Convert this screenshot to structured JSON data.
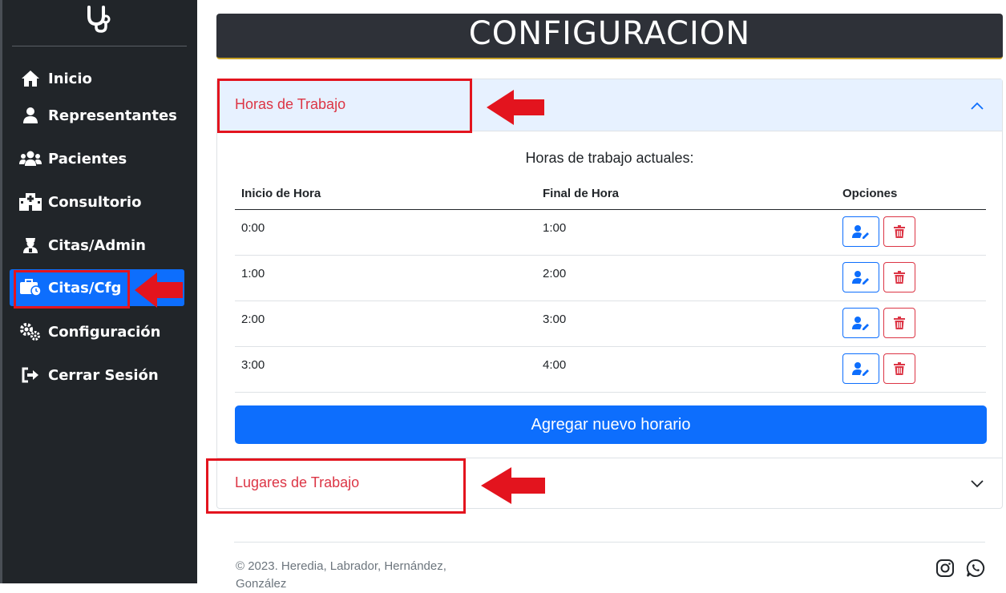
{
  "page_title": "CONFIGURACION",
  "sidebar": {
    "logo_icon": "stethoscope-icon",
    "items": [
      {
        "label": "Inicio",
        "icon": "house-icon"
      },
      {
        "label": "Representantes",
        "icon": "user-icon"
      },
      {
        "label": "Pacientes",
        "icon": "users-icon"
      },
      {
        "label": "Consultorio",
        "icon": "hospital-icon"
      },
      {
        "label": "Citas/Admin",
        "icon": "user-nurse-icon"
      },
      {
        "label": "Citas/Cfg",
        "icon": "briefcase-clock-icon",
        "active": true
      },
      {
        "label": "Configuración",
        "icon": "gears-icon"
      },
      {
        "label": "Cerrar Sesión",
        "icon": "sign-out-icon"
      }
    ]
  },
  "accordion": {
    "section1": {
      "title": "Horas de Trabajo",
      "expanded": true,
      "subtitle": "Horas de trabajo actuales:",
      "columns": [
        "Inicio de Hora",
        "Final de Hora",
        "Opciones"
      ],
      "rows": [
        {
          "start": "0:00",
          "end": "1:00"
        },
        {
          "start": "1:00",
          "end": "2:00"
        },
        {
          "start": "2:00",
          "end": "3:00"
        },
        {
          "start": "3:00",
          "end": "4:00"
        }
      ],
      "add_button": "Agregar nuevo horario"
    },
    "section2": {
      "title": "Lugares de Trabajo",
      "expanded": false
    }
  },
  "footer": {
    "text": "© 2023. Heredia, Labrador, Hernández, González"
  },
  "colors": {
    "sidebar_bg": "#212529",
    "accent": "#0d6efd",
    "danger": "#dc3545",
    "annotation": "#e3141e"
  }
}
